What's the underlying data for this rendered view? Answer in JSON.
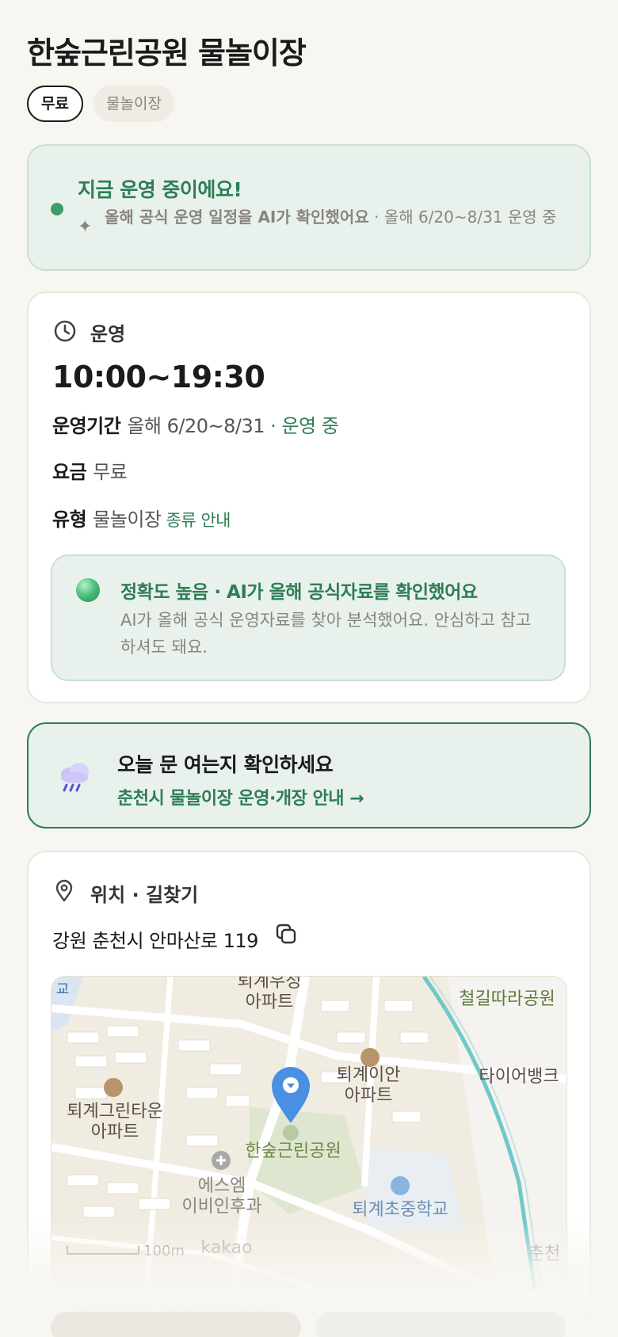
{
  "park": {
    "title": "한숲근린공원 물놀이장",
    "tags": [
      "무료",
      "물놀이장"
    ]
  },
  "status": {
    "title": "지금 운영 중이에요!",
    "verified_text": "올해 공식 운영 일정을 AI가 확인했어요",
    "separator": " · ",
    "period_text": "올해 6/20~8/31 운영 중",
    "dot_color": "#3a9e6a",
    "icons": [
      "sparkle-icon"
    ]
  },
  "operation": {
    "label": "운영",
    "hours": "10:00~19:30",
    "period_label": "운영기간",
    "period_value": "올해 6/20~8/31",
    "period_sep": " · ",
    "period_status": "운영 중",
    "fee_label": "요금",
    "fee_value": "무료",
    "type_label": "유형",
    "type_value": "물놀이장",
    "type_link": "종류 안내",
    "accuracy_title": "정확도 높음 · AI가 올해 공식자료를 확인했어요",
    "accuracy_desc": "AI가 올해 공식 운영자료를 찾아 분석했어요. 안심하고 참고하셔도 돼요."
  },
  "alert": {
    "title": "오늘 문 여는지 확인하세요",
    "link": "춘천시 물놀이장 운영·개장 안내 →",
    "icon": "rain-cloud-icon"
  },
  "location": {
    "label": "위치 · 길찾기",
    "address": "강원 춘천시 안마산로 119",
    "map": {
      "labels": {
        "apt_top": "퇴계우성\n아파트",
        "park_rail": "철길따라공원",
        "tire": "타이어뱅크",
        "apt_green": "퇴계그린타운\n아파트",
        "apt_ian": "퇴계이안\n아파트",
        "park_main": "한숲근린공원",
        "clinic": "에스엠\n이비인후과",
        "school": "퇴계초중학교",
        "chuncheon": "춘천",
        "edge_school": "교"
      },
      "scale": "100m",
      "brand": "kakao"
    }
  },
  "colors": {
    "accent": "#2e7d56",
    "background": "#f8f6f1",
    "card_green": "#e8f1ec",
    "muted": "#8a857c",
    "marker": "#4a90e2"
  }
}
